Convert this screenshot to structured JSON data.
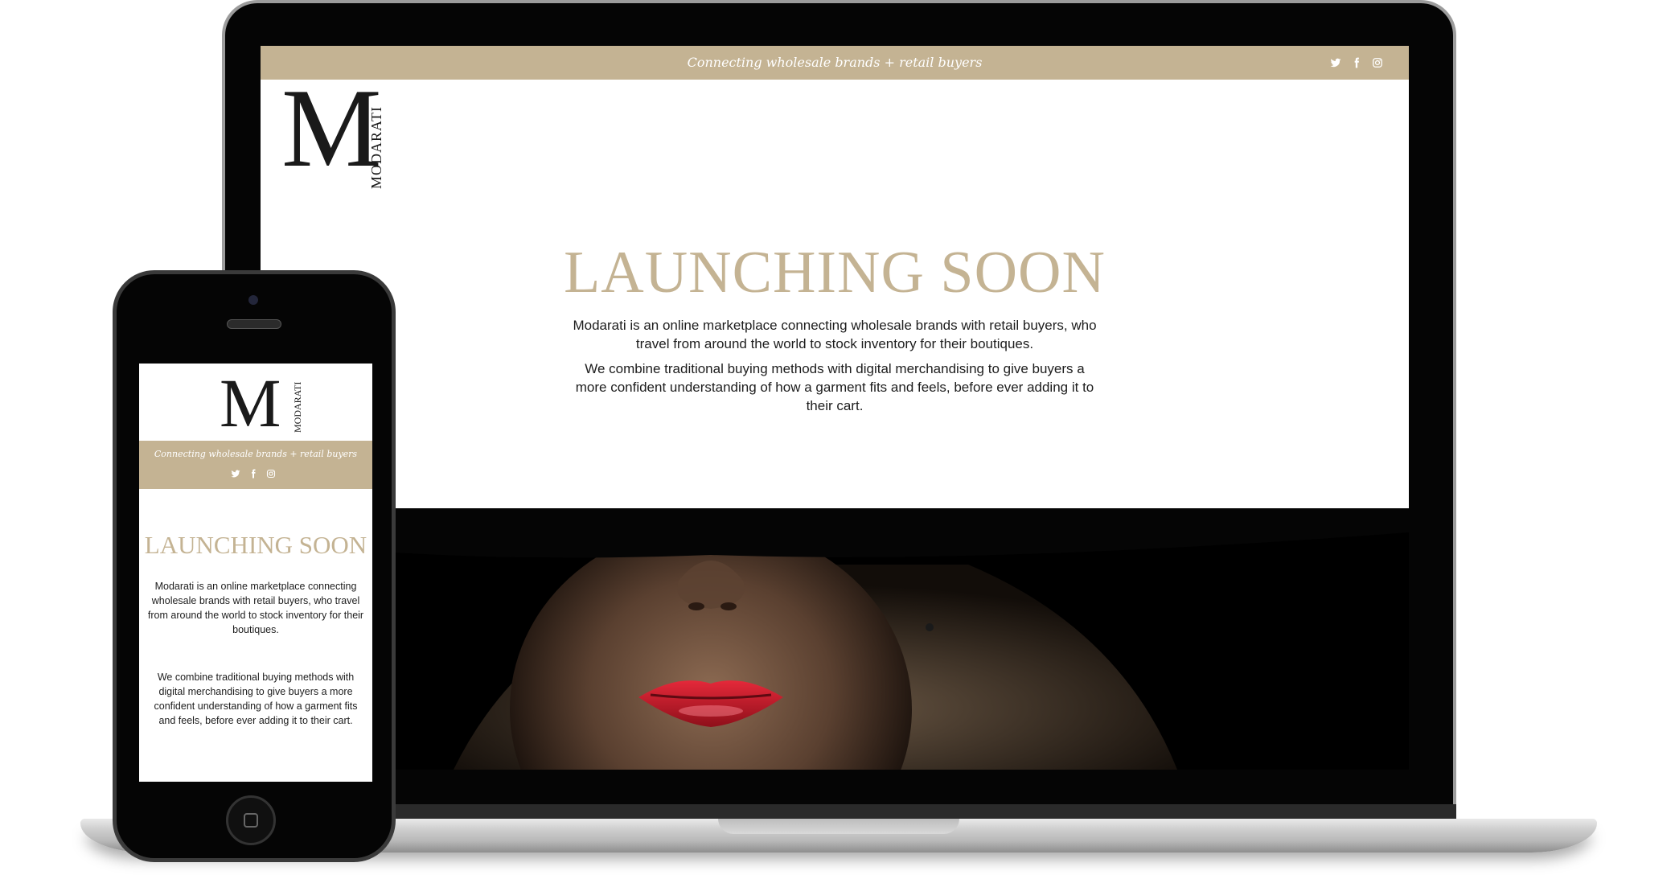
{
  "site": {
    "logo_letter": "M",
    "logo_word": "MODARATI",
    "tagline": "Connecting wholesale brands + retail buyers",
    "heading": "LAUNCHING SOON",
    "paragraph_1": "Modarati is an online marketplace connecting wholesale brands with retail buyers, who travel from around the world to stock inventory for their boutiques.",
    "paragraph_2": "We combine traditional buying methods with digital merchandising to give buyers a more confident understanding of how a garment fits and feels, before ever adding it to their cart.",
    "social": [
      "twitter-icon",
      "facebook-icon",
      "instagram-icon"
    ]
  },
  "colors": {
    "accent": "#c4b393",
    "text": "#1d1d1d",
    "lips": "#c81e2c"
  }
}
